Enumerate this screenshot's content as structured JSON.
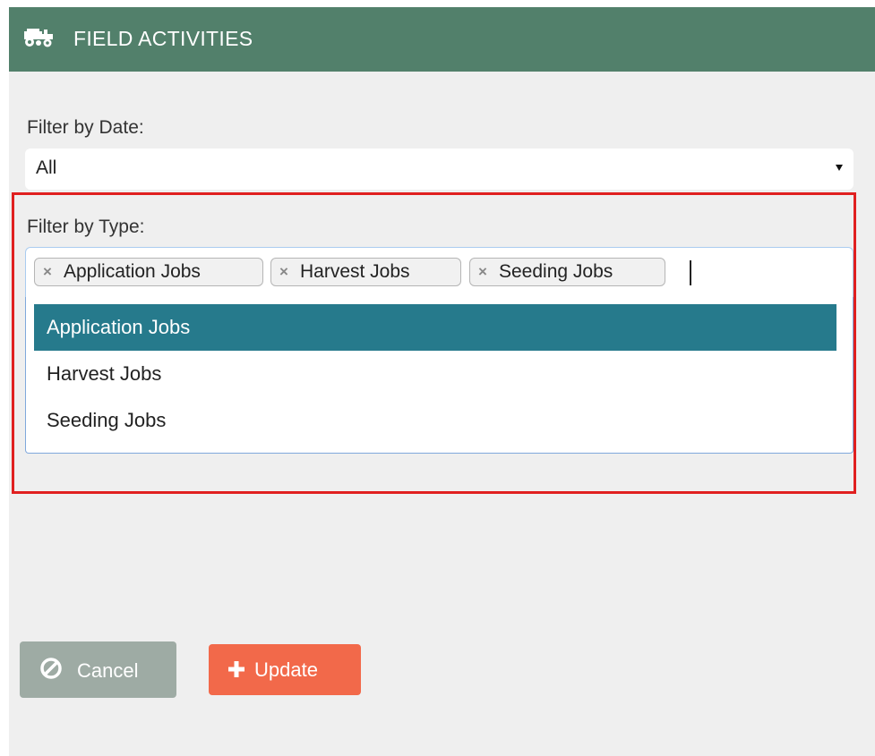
{
  "panel": {
    "title": "FIELD ACTIVITIES",
    "header_icon": "tractor-icon",
    "header_color": "#52806b"
  },
  "date_filter": {
    "label": "Filter by Date:",
    "selected": "All"
  },
  "type_filter": {
    "label": "Filter by Type:",
    "selected_tags": [
      {
        "label": "Application Jobs",
        "remove": "×"
      },
      {
        "label": "Harvest Jobs",
        "remove": "×"
      },
      {
        "label": "Seeding Jobs",
        "remove": "×"
      }
    ],
    "options": [
      {
        "label": "Application Jobs",
        "highlighted": true
      },
      {
        "label": "Harvest Jobs",
        "highlighted": false
      },
      {
        "label": "Seeding Jobs",
        "highlighted": false
      }
    ],
    "highlight_color": "#267a8c",
    "annotation_color": "#e02020"
  },
  "buttons": {
    "cancel": {
      "label": "Cancel",
      "icon": "ban-icon",
      "color": "#9eaba4"
    },
    "update": {
      "label": "Update",
      "icon": "plus-icon",
      "color": "#f2694a"
    }
  }
}
